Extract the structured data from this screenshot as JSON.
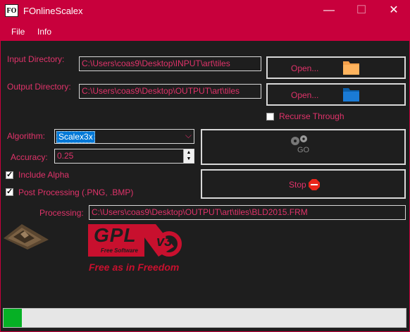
{
  "window": {
    "title": "FOnlineScalex",
    "icon_text": "FO"
  },
  "controls": {
    "minimize": "—",
    "maximize": "☐",
    "close": "✕"
  },
  "menu": [
    {
      "label": "File"
    },
    {
      "label": "Info"
    }
  ],
  "input_dir": {
    "label": "Input Directory:",
    "value": "C:\\Users\\coas9\\Desktop\\INPUT\\art\\tiles",
    "button": "Open..."
  },
  "output_dir": {
    "label": "Output Directory:",
    "value": "C:\\Users\\coas9\\Desktop\\OUTPUT\\art\\tiles",
    "button": "Open..."
  },
  "recurse": {
    "label": "Recurse Through",
    "checked": false
  },
  "algorithm": {
    "label": "Algorithm:",
    "value": "Scalex3x"
  },
  "accuracy": {
    "label": "Accuracy:",
    "value": "0.25"
  },
  "include_alpha": {
    "label": "Include Alpha",
    "checked": true
  },
  "post_processing": {
    "label": "Post Processing (.PNG, .BMP)",
    "checked": true
  },
  "go_button": {
    "label": "GO"
  },
  "stop_button": {
    "label": "Stop"
  },
  "processing": {
    "label": "Processing:",
    "value": "C:\\Users\\coas9\\Desktop\\OUTPUT\\art\\tiles\\BLD2015.FRM"
  },
  "gpl_logo": {
    "text": "GPL",
    "sub": "Free Software",
    "version": "v3",
    "tagline": "Free as in Freedom"
  },
  "progress": {
    "fraction": 0.045
  },
  "colors": {
    "accent": "#c8003c",
    "label": "#e0336a",
    "bg": "#1e1e1e",
    "progress": "#06b025"
  }
}
